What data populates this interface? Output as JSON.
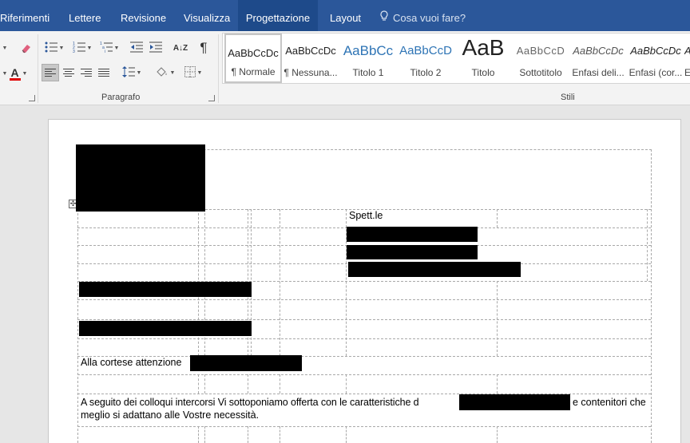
{
  "tabs": [
    {
      "label": "Riferimenti"
    },
    {
      "label": "Lettere"
    },
    {
      "label": "Revisione"
    },
    {
      "label": "Visualizza"
    },
    {
      "label": "Progettazione"
    },
    {
      "label": "Layout"
    }
  ],
  "tell_me": {
    "label": "Cosa vuoi fare?",
    "icon": "lightbulb-icon"
  },
  "ribbon": {
    "paragraph_group_label": "Paragrafo",
    "styles_group_label": "Stili",
    "sort_glyph": "A↓Z",
    "pilcrow_glyph": "¶",
    "font_color_glyph": "A"
  },
  "styles": [
    {
      "preview": "AaBbCcDc",
      "name": "¶ Normale"
    },
    {
      "preview": "AaBbCcDc",
      "name": "¶ Nessuna..."
    },
    {
      "preview": "AaBbCc",
      "name": "Titolo 1"
    },
    {
      "preview": "AaBbCcD",
      "name": "Titolo 2"
    },
    {
      "preview": "AaB",
      "name": "Titolo"
    },
    {
      "preview": "AaBbCcD",
      "name": "Sottotitolo"
    },
    {
      "preview": "AaBbCcDc",
      "name": "Enfasi deli..."
    },
    {
      "preview": "AaBbCcDc",
      "name": "Enfasi (cor..."
    },
    {
      "preview": "A",
      "name": "E"
    }
  ],
  "document": {
    "recipient_label": "Spett.le",
    "attention_text": "Alla cortese attenzione",
    "body_line1_prefix": "A seguito dei colloqui intercorsi Vi sottoponiamo offerta con le caratteristiche d",
    "body_line1_suffix": "e contenitori che",
    "body_line2": "meglio si adattano alle Vostre necessità."
  },
  "colors": {
    "title_bar": "#2b579a",
    "active_tab": "#1e4a8a",
    "ribbon_bg": "#f3f3f3",
    "canvas_bg": "#e6e6e6",
    "heading_blue": "#2e74b5",
    "font_color_red": "#e00000"
  }
}
